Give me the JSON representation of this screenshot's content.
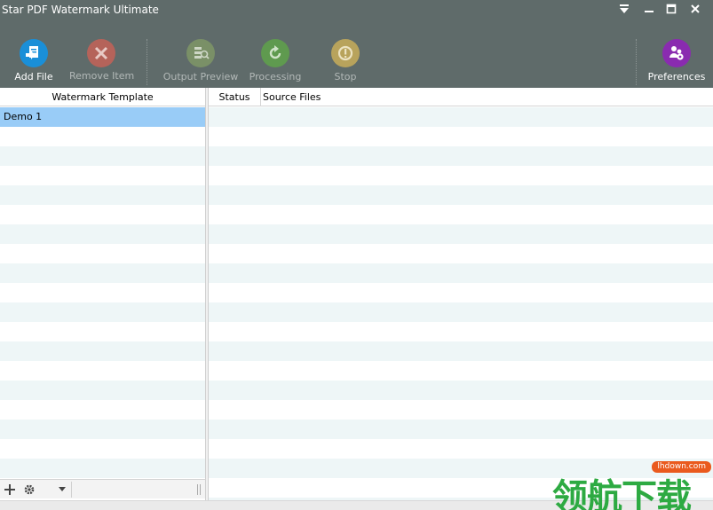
{
  "window": {
    "title": "Star PDF Watermark Ultimate"
  },
  "toolbar": {
    "add_file": "Add File",
    "remove_item": "Remove Item",
    "output_preview": "Output Preview",
    "processing": "Processing",
    "stop": "Stop",
    "preferences": "Preferences"
  },
  "left_panel": {
    "header": "Watermark Template",
    "items": [
      "Demo 1"
    ]
  },
  "right_panel": {
    "columns": {
      "status": "Status",
      "source_files": "Source Files"
    }
  },
  "watermark": {
    "site": "lhdown.com",
    "text": "领航下载"
  },
  "colors": {
    "toolbar_bg": "#5f6b6a",
    "selected_row": "#99ccf7",
    "alt_row": "#eef6f7",
    "add_file": "#1a8fd8",
    "remove": "#c0564a",
    "preferences": "#8a2bb0"
  }
}
